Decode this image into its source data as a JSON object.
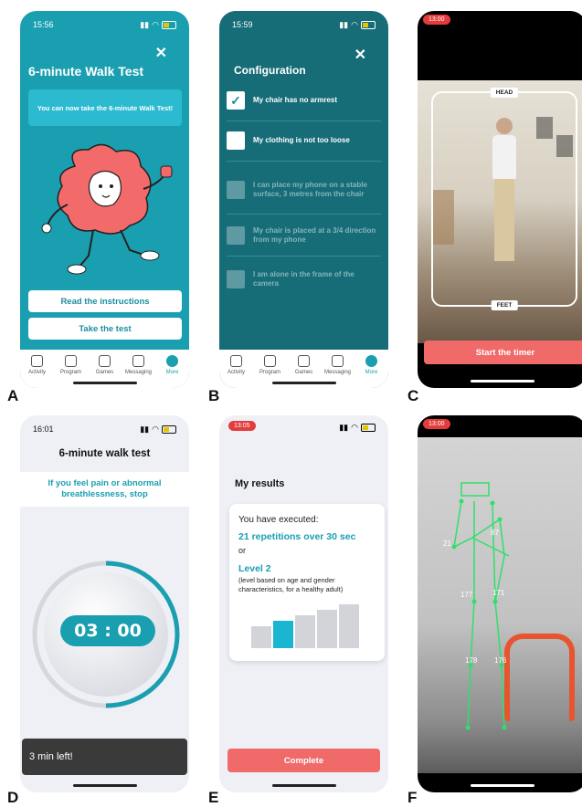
{
  "labels": [
    "A",
    "B",
    "C",
    "D",
    "E",
    "F"
  ],
  "panelA": {
    "time": "15:56",
    "title": "6-minute Walk Test",
    "info": "You can now take the 6-minute Walk Test!",
    "btn_instructions": "Read the instructions",
    "btn_test": "Take the test"
  },
  "tabs": [
    "Activity",
    "Program",
    "Games",
    "Messaging",
    "More"
  ],
  "panelB": {
    "time": "15:59",
    "title": "Configuration",
    "items": [
      "My chair has no armrest",
      "My clothing is not too loose",
      "I can place my phone on a stable surface, 3 metres from the chair",
      "My chair is placed at a 3/4 direction from my phone",
      "I am alone in the frame of the camera"
    ]
  },
  "panelC": {
    "time": "13:00",
    "head": "HEAD",
    "feet": "FEET",
    "btn": "Start the timer"
  },
  "panelD": {
    "time": "16:01",
    "title": "6-minute walk test",
    "warning": "If you feel pain or abnormal breathlessness, stop",
    "timer": "03 : 00",
    "toast": "3 min left!",
    "progress": 0.5
  },
  "panelE": {
    "time": "13:05",
    "title": "My results",
    "executed": "You have executed:",
    "reps": "21 repetitions over 30 sec",
    "or": "or",
    "level": "Level 2",
    "level_note": "(level based on age and gender characteristics, for a healthy adult)",
    "levels": [
      1,
      2,
      3,
      4,
      5
    ],
    "selected_level": 2,
    "btn": "Complete"
  },
  "panelF": {
    "time": "13:00",
    "angles": [
      "21",
      "87",
      "177",
      "171",
      "178",
      "176"
    ]
  },
  "colors": {
    "teal": "#1a9fb0",
    "darkteal": "#166c77",
    "coral": "#f06a6a"
  }
}
